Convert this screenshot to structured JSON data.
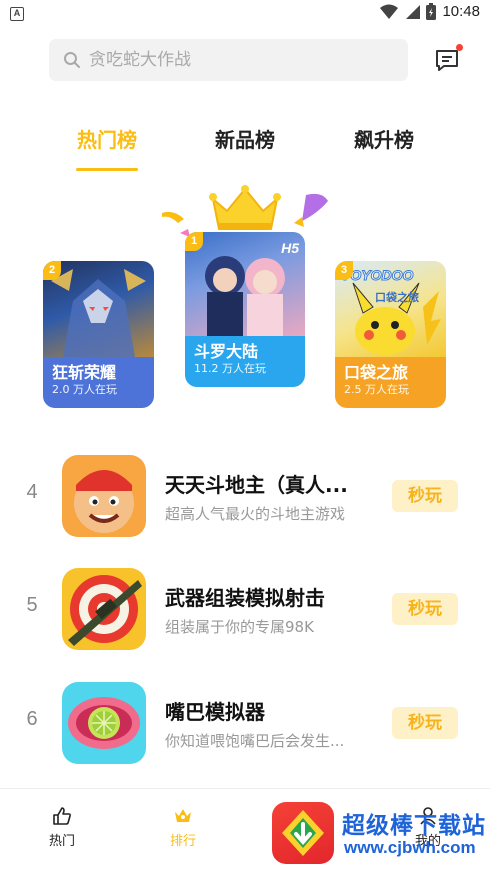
{
  "status_bar": {
    "time": "10:48"
  },
  "search": {
    "placeholder": "贪吃蛇大作战"
  },
  "tabs": [
    {
      "label": "热门榜",
      "active": true
    },
    {
      "label": "新品榜",
      "active": false
    },
    {
      "label": "飙升榜",
      "active": false
    }
  ],
  "podium": [
    {
      "rank": "2",
      "name": "狂斩荣耀",
      "plays": "2.0 万人在玩"
    },
    {
      "rank": "1",
      "name": "斗罗大陆",
      "plays": "11.2 万人在玩",
      "art_text": "H5"
    },
    {
      "rank": "3",
      "name": "口袋之旅",
      "plays": "2.5 万人在玩",
      "art_text": "YOYODOO",
      "art_text2": "口袋之旅"
    }
  ],
  "list": [
    {
      "rank": "4",
      "title": "天天斗地主（真人...",
      "desc": "超高人气最火的斗地主游戏",
      "button": "秒玩"
    },
    {
      "rank": "5",
      "title": "武器组装模拟射击",
      "desc": "组装属于你的专属98K",
      "button": "秒玩"
    },
    {
      "rank": "6",
      "title": "嘴巴模拟器",
      "desc": "你知道喂饱嘴巴后会发生...",
      "button": "秒玩"
    }
  ],
  "nav": [
    {
      "label": "热门",
      "icon": "thumbs-up-icon",
      "active": false
    },
    {
      "label": "排行",
      "icon": "crown-icon",
      "active": true
    },
    {
      "label": "我的",
      "icon": "user-icon",
      "active": false
    }
  ],
  "watermark": {
    "title": "超级棒下载站",
    "url": "www.cjbwh.com"
  },
  "colors": {
    "accent": "#fbbd13",
    "blue_card": "#4d73d9",
    "sky_card": "#29a6ee",
    "orange_card": "#f6a325",
    "play_bg": "#fff1c7",
    "watermark": "#1e63d8"
  }
}
